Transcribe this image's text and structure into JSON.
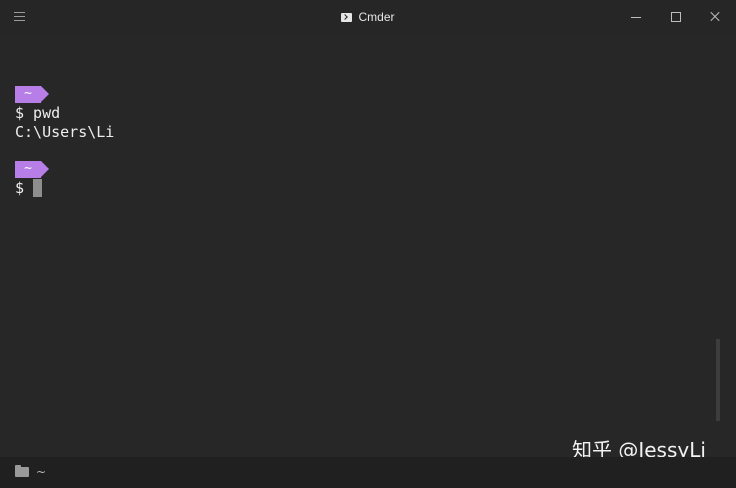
{
  "window": {
    "title": "Cmder"
  },
  "terminal": {
    "blocks": [
      {
        "tag": "~",
        "prompt": "$ pwd",
        "output": "C:\\Users\\Li"
      },
      {
        "tag": "~",
        "prompt": "$ "
      }
    ]
  },
  "watermark": "知乎 @JessyLi",
  "statusbar": {
    "path": "~"
  },
  "colors": {
    "background": "#272727",
    "prompt_tag": "#b77ee8",
    "text": "#eeeeee"
  },
  "icons": {
    "menu": "hamburger-menu-icon",
    "app": "terminal-prompt-icon",
    "minimize": "minimize-icon",
    "maximize": "maximize-icon",
    "close": "close-icon",
    "status": "folder-icon"
  }
}
